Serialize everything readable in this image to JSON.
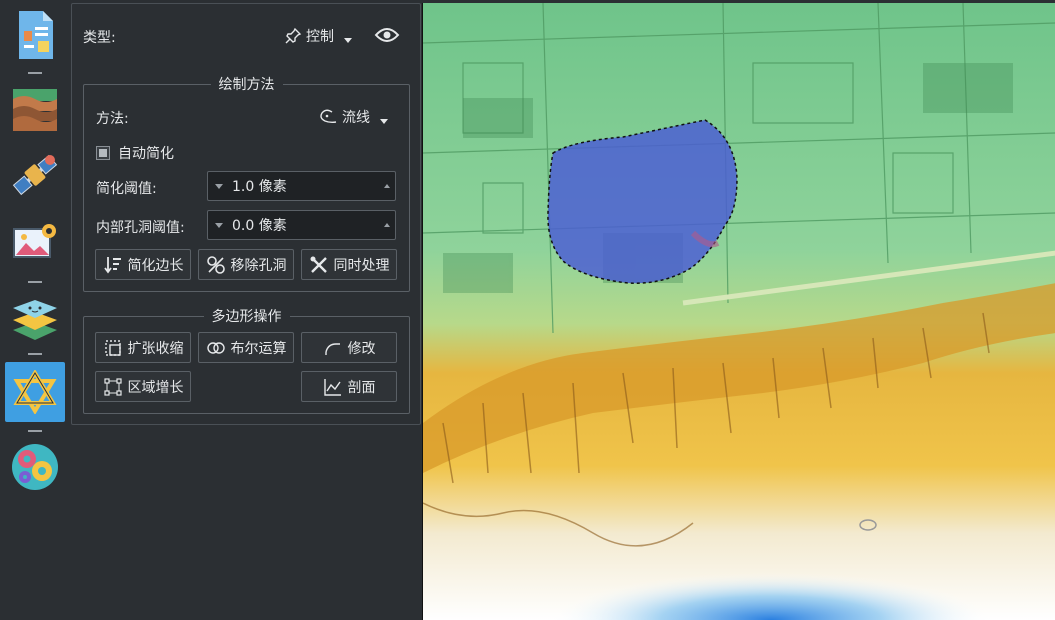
{
  "panel": {
    "type_label": "类型:",
    "type_value": "控制",
    "draw_group_title": "绘制方法",
    "method_label": "方法:",
    "method_value": "流线",
    "auto_simplify_label": "自动简化",
    "simplify_threshold_label": "简化阈值:",
    "simplify_threshold_value": "1.0 像素",
    "hole_threshold_label": "内部孔洞阈值:",
    "hole_threshold_value": "0.0 像素",
    "buttons_row1": [
      "简化边长",
      "移除孔洞",
      "同时处理"
    ],
    "polygon_group_title": "多边形操作",
    "buttons_row2": [
      "扩张收缩",
      "布尔运算",
      "修改"
    ],
    "buttons_row3": [
      "区域增长",
      "剖面"
    ]
  },
  "rail": {
    "icons": [
      "document-icon",
      "terrain-layers-icon",
      "satellite-icon",
      "image-settings-icon",
      "layers-icon",
      "star-of-david-icon",
      "gears-icon"
    ],
    "active_index": 5
  },
  "colors": {
    "accent": "#3f9fe2",
    "panel_bg": "#2b2f33",
    "polygon_fill": "#4a5bd6"
  }
}
